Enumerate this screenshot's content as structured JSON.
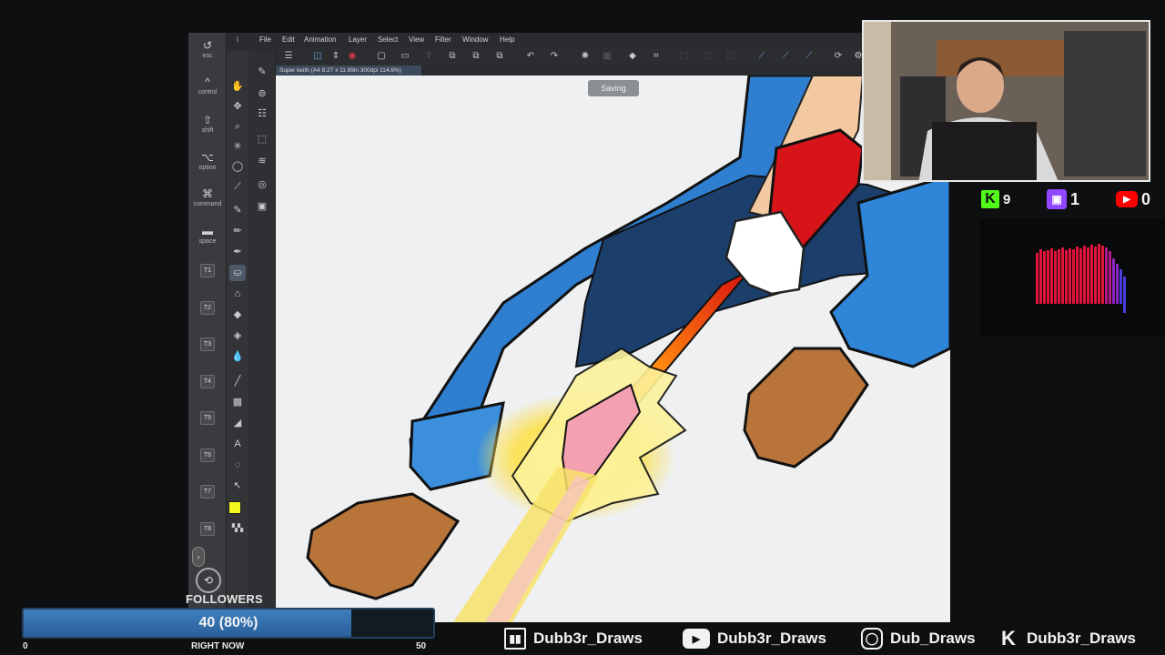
{
  "app": {
    "menu": [
      "File",
      "Edit",
      "Animation",
      "Layer",
      "Select",
      "View",
      "Filter",
      "Window",
      "Help"
    ],
    "document_tab": "Super keith (A4 8.27 x 11.69in 300dpi 114.6%)",
    "saving_toast": "Saving",
    "modifier_keys": [
      {
        "glyph": "↺",
        "label": "esc"
      },
      {
        "glyph": "^",
        "label": "control"
      },
      {
        "glyph": "⇧",
        "label": "shift"
      },
      {
        "glyph": "⌥",
        "label": "option"
      },
      {
        "glyph": "⌘",
        "label": "command"
      },
      {
        "glyph": "▬",
        "label": "space"
      }
    ],
    "tool_keys": [
      "T1",
      "T2",
      "T3",
      "T4",
      "T5",
      "T6",
      "T7",
      "T8"
    ],
    "colors": {
      "main": "#f4f71e",
      "sub": "#6a6a6a",
      "accent": "#5b9bd9"
    }
  },
  "counters": {
    "kick": {
      "icon": "kick-icon",
      "value": "9",
      "color": "#53fc18"
    },
    "twitch": {
      "icon": "twitch-icon",
      "value": "1",
      "color": "#9146ff"
    },
    "youtube": {
      "icon": "youtube-icon",
      "value": "0",
      "color": "#ff0000"
    }
  },
  "followers": {
    "title": "FOLLOWERS",
    "text": "40 (80%)",
    "progress": 0.8,
    "min": "0",
    "max": "50",
    "right_label": "RIGHT NOW"
  },
  "socials": [
    {
      "icon": "twitch-icon",
      "handle": "Dubb3r_Draws"
    },
    {
      "icon": "youtube-icon",
      "handle": "Dubb3r_Draws"
    },
    {
      "icon": "instagram-icon",
      "handle": "Dub_Draws"
    },
    {
      "icon": "kick-icon",
      "handle": "Dubb3r_Draws"
    }
  ]
}
